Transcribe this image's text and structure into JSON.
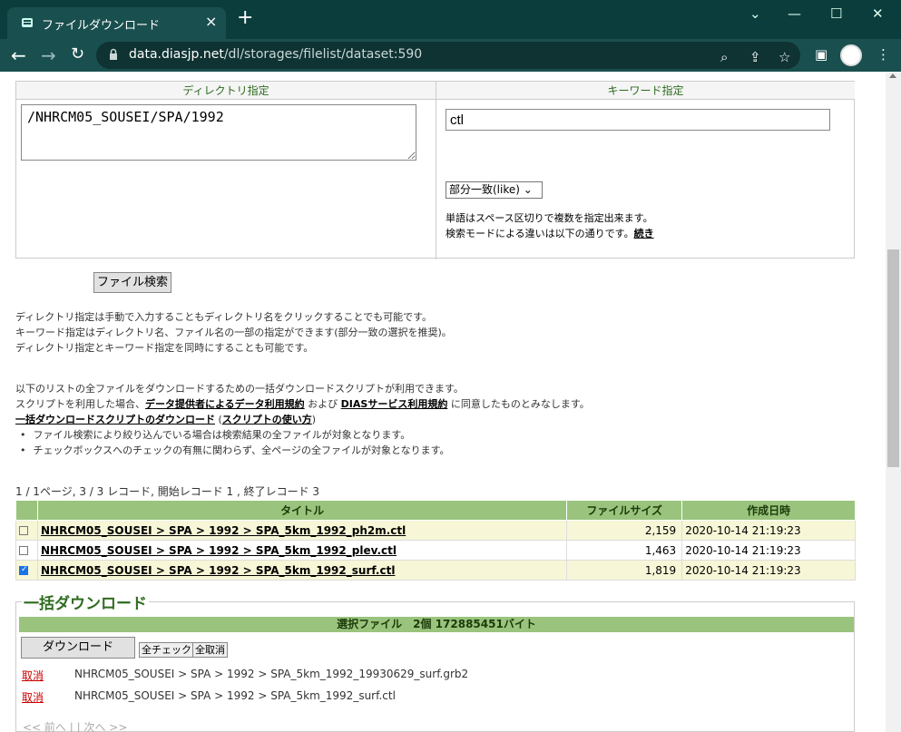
{
  "browser": {
    "tab_title": "ファイルダウンロード",
    "url_domain": "data.diasjp.net",
    "url_path": "/dl/storages/filelist/dataset:590",
    "accent": "#1a4f4f"
  },
  "search": {
    "dir_header": "ディレクトリ指定",
    "kw_header": "キーワード指定",
    "dir_value": "/NHRCM05_SOUSEI/SPA/1992",
    "kw_value": "ctl",
    "mode_value": "部分一致(like)",
    "hint_line1": "単語はスペース区切りで複数を指定出来ます。",
    "hint_line2": "検索モードによる違いは以下の通りです。",
    "hint_link": "続き",
    "button": "ファイル検索"
  },
  "info": {
    "line1": "ディレクトリ指定は手動で入力することもディレクトリ名をクリックすることでも可能です。",
    "line2": "キーワード指定はディレクトリ名、ファイル名の一部の指定ができます(部分一致の選択を推奨)。",
    "line3": "ディレクトリ指定とキーワード指定を同時にすることも可能です。",
    "line4": "以下のリストの全ファイルをダウンロードするための一括ダウンロードスクリプトが利用できます。",
    "line5_a": "スクリプトを利用した場合、",
    "line5_link1": "データ提供者によるデータ利用規約",
    "line5_b": " および ",
    "line5_link2": "DIASサービス利用規約",
    "line5_c": " に同意したものとみなします。",
    "script_link": "一括ダウンロードスクリプトのダウンロード",
    "howto_link": "スクリプトの使い方",
    "bullet1": "ファイル検索により絞り込んでいる場合は検索結果の全ファイルが対象となります。",
    "bullet2": "チェックボックスへのチェックの有無に関わらず、全ページの全ファイルが対象となります。"
  },
  "results": {
    "record_info": "1 / 1ページ, 3 / 3 レコード, 開始レコード 1 , 終了レコード 3",
    "headers": {
      "title": "タイトル",
      "size": "ファイルサイズ",
      "date": "作成日時"
    },
    "rows": [
      {
        "title": "NHRCM05_SOUSEI > SPA > 1992 > SPA_5km_1992_ph2m.ctl",
        "size": "2,159",
        "date": "2020-10-14 21:19:23",
        "checked": false
      },
      {
        "title": "NHRCM05_SOUSEI > SPA > 1992 > SPA_5km_1992_plev.ctl",
        "size": "1,463",
        "date": "2020-10-14 21:19:23",
        "checked": false
      },
      {
        "title": "NHRCM05_SOUSEI > SPA > 1992 > SPA_5km_1992_surf.ctl",
        "size": "1,819",
        "date": "2020-10-14 21:19:23",
        "checked": true
      }
    ]
  },
  "bulk": {
    "title": "一括ダウンロード",
    "summary": "選択ファイル　2個 172885451バイト",
    "download": "ダウンロード",
    "check_all": "全チェック",
    "cancel_all": "全取消",
    "cancel": "取消",
    "items": [
      "NHRCM05_SOUSEI > SPA > 1992 > SPA_5km_1992_19930629_surf.grb2",
      "NHRCM05_SOUSEI > SPA > 1992 > SPA_5km_1992_surf.ctl"
    ],
    "pager": "<< 前へ | | 次へ >>"
  }
}
